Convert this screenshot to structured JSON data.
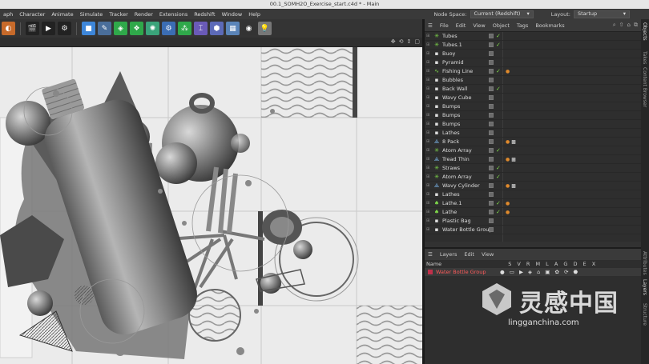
{
  "window": {
    "title": "00.1_SOMH2O_Exercise_start.c4d * - Main"
  },
  "menu": {
    "items": [
      "aph",
      "Character",
      "Animate",
      "Simulate",
      "Tracker",
      "Render",
      "Extensions",
      "Redshift",
      "Window",
      "Help"
    ],
    "node_space_label": "Node Space:",
    "node_space_value": "Current (Redshift)",
    "layout_label": "Layout:",
    "layout_value": "Startup"
  },
  "object_manager": {
    "menu": [
      "File",
      "Edit",
      "View",
      "Object",
      "Tags",
      "Bookmarks"
    ],
    "objects": [
      {
        "name": "Tubes",
        "icon": "atom-array-icon",
        "color": "#7ed84a",
        "glyph": "✳",
        "check": "✓",
        "tags": []
      },
      {
        "name": "Tubes.1",
        "icon": "atom-array-icon",
        "color": "#7ed84a",
        "glyph": "✳",
        "check": "✓",
        "tags": []
      },
      {
        "name": "Buoy",
        "icon": "null-object-icon",
        "color": "#dddddd",
        "glyph": "▪",
        "check": "",
        "tags": []
      },
      {
        "name": "Pyramid",
        "icon": "null-object-icon",
        "color": "#dddddd",
        "glyph": "▪",
        "check": "",
        "tags": []
      },
      {
        "name": "Fishing Line",
        "icon": "spline-icon",
        "color": "#7ed84a",
        "glyph": "∿",
        "check": "✓",
        "tags": [
          "material-tag"
        ]
      },
      {
        "name": "Bubbles",
        "icon": "null-object-icon",
        "color": "#dddddd",
        "glyph": "▪",
        "check": "",
        "tags": []
      },
      {
        "name": "Back Wall",
        "icon": "null-object-icon",
        "color": "#dddddd",
        "glyph": "▪",
        "check": "✓",
        "tags": []
      },
      {
        "name": "Wavy Cube",
        "icon": "null-object-icon",
        "color": "#dddddd",
        "glyph": "▪",
        "check": "",
        "tags": []
      },
      {
        "name": "Bumps",
        "icon": "null-object-icon",
        "color": "#dddddd",
        "glyph": "▪",
        "check": "",
        "tags": []
      },
      {
        "name": "Bumps",
        "icon": "null-object-icon",
        "color": "#dddddd",
        "glyph": "▪",
        "check": "",
        "tags": []
      },
      {
        "name": "Bumps",
        "icon": "null-object-icon",
        "color": "#dddddd",
        "glyph": "▪",
        "check": "",
        "tags": []
      },
      {
        "name": "Lathes",
        "icon": "null-object-icon",
        "color": "#dddddd",
        "glyph": "▪",
        "check": "",
        "tags": []
      },
      {
        "name": "8 Pack",
        "icon": "cloner-icon",
        "color": "#7ab4e8",
        "glyph": "⟁",
        "check": "",
        "tags": [
          "material-tag",
          "checker-tag"
        ]
      },
      {
        "name": "Atom Array",
        "icon": "atom-array-icon",
        "color": "#7ed84a",
        "glyph": "✳",
        "check": "✓",
        "tags": []
      },
      {
        "name": "Tread Thin",
        "icon": "cloner-icon",
        "color": "#7ab4e8",
        "glyph": "⟁",
        "check": "",
        "tags": [
          "material-tag",
          "checker-tag"
        ]
      },
      {
        "name": "Straws",
        "icon": "atom-array-icon",
        "color": "#7ed84a",
        "glyph": "✳",
        "check": "✓",
        "tags": []
      },
      {
        "name": "Atom Array",
        "icon": "atom-array-icon",
        "color": "#7ed84a",
        "glyph": "✳",
        "check": "✓",
        "tags": []
      },
      {
        "name": "Wavy Cylinder",
        "icon": "cloner-icon",
        "color": "#7ab4e8",
        "glyph": "⟁",
        "check": "",
        "tags": [
          "material-tag",
          "checker-tag"
        ]
      },
      {
        "name": "Lathes",
        "icon": "null-object-icon",
        "color": "#dddddd",
        "glyph": "▪",
        "check": "",
        "tags": []
      },
      {
        "name": "Lathe.1",
        "icon": "lathe-icon",
        "color": "#7ed84a",
        "glyph": "♠",
        "check": "✓",
        "tags": [
          "material-tag"
        ]
      },
      {
        "name": "Lathe",
        "icon": "lathe-icon",
        "color": "#7ed84a",
        "glyph": "♠",
        "check": "✓",
        "tags": [
          "material-tag"
        ]
      },
      {
        "name": "Plastic Bag",
        "icon": "null-object-icon",
        "color": "#dddddd",
        "glyph": "▪",
        "check": "",
        "tags": []
      },
      {
        "name": "Water Bottle Group",
        "icon": "null-object-icon",
        "color": "#dddddd",
        "glyph": "▪",
        "check": "",
        "tags": []
      }
    ]
  },
  "layers": {
    "menu": [
      "Layers",
      "Edit",
      "View"
    ],
    "header_name": "Name",
    "header_cols": "S V R M L A G D E X",
    "rows": [
      {
        "name": "Water Bottle Group",
        "color": "#c0304a",
        "icons": "● ▭ ▶ ◈ ⌂ ▣ ✿ ⟳ ⬣"
      }
    ]
  },
  "side_tabs": [
    "Objects",
    "Takes",
    "Content Browser",
    "Attributes",
    "Layers",
    "Structure"
  ],
  "watermark": {
    "cn": "灵感中国",
    "url": "lingganchina.com"
  }
}
